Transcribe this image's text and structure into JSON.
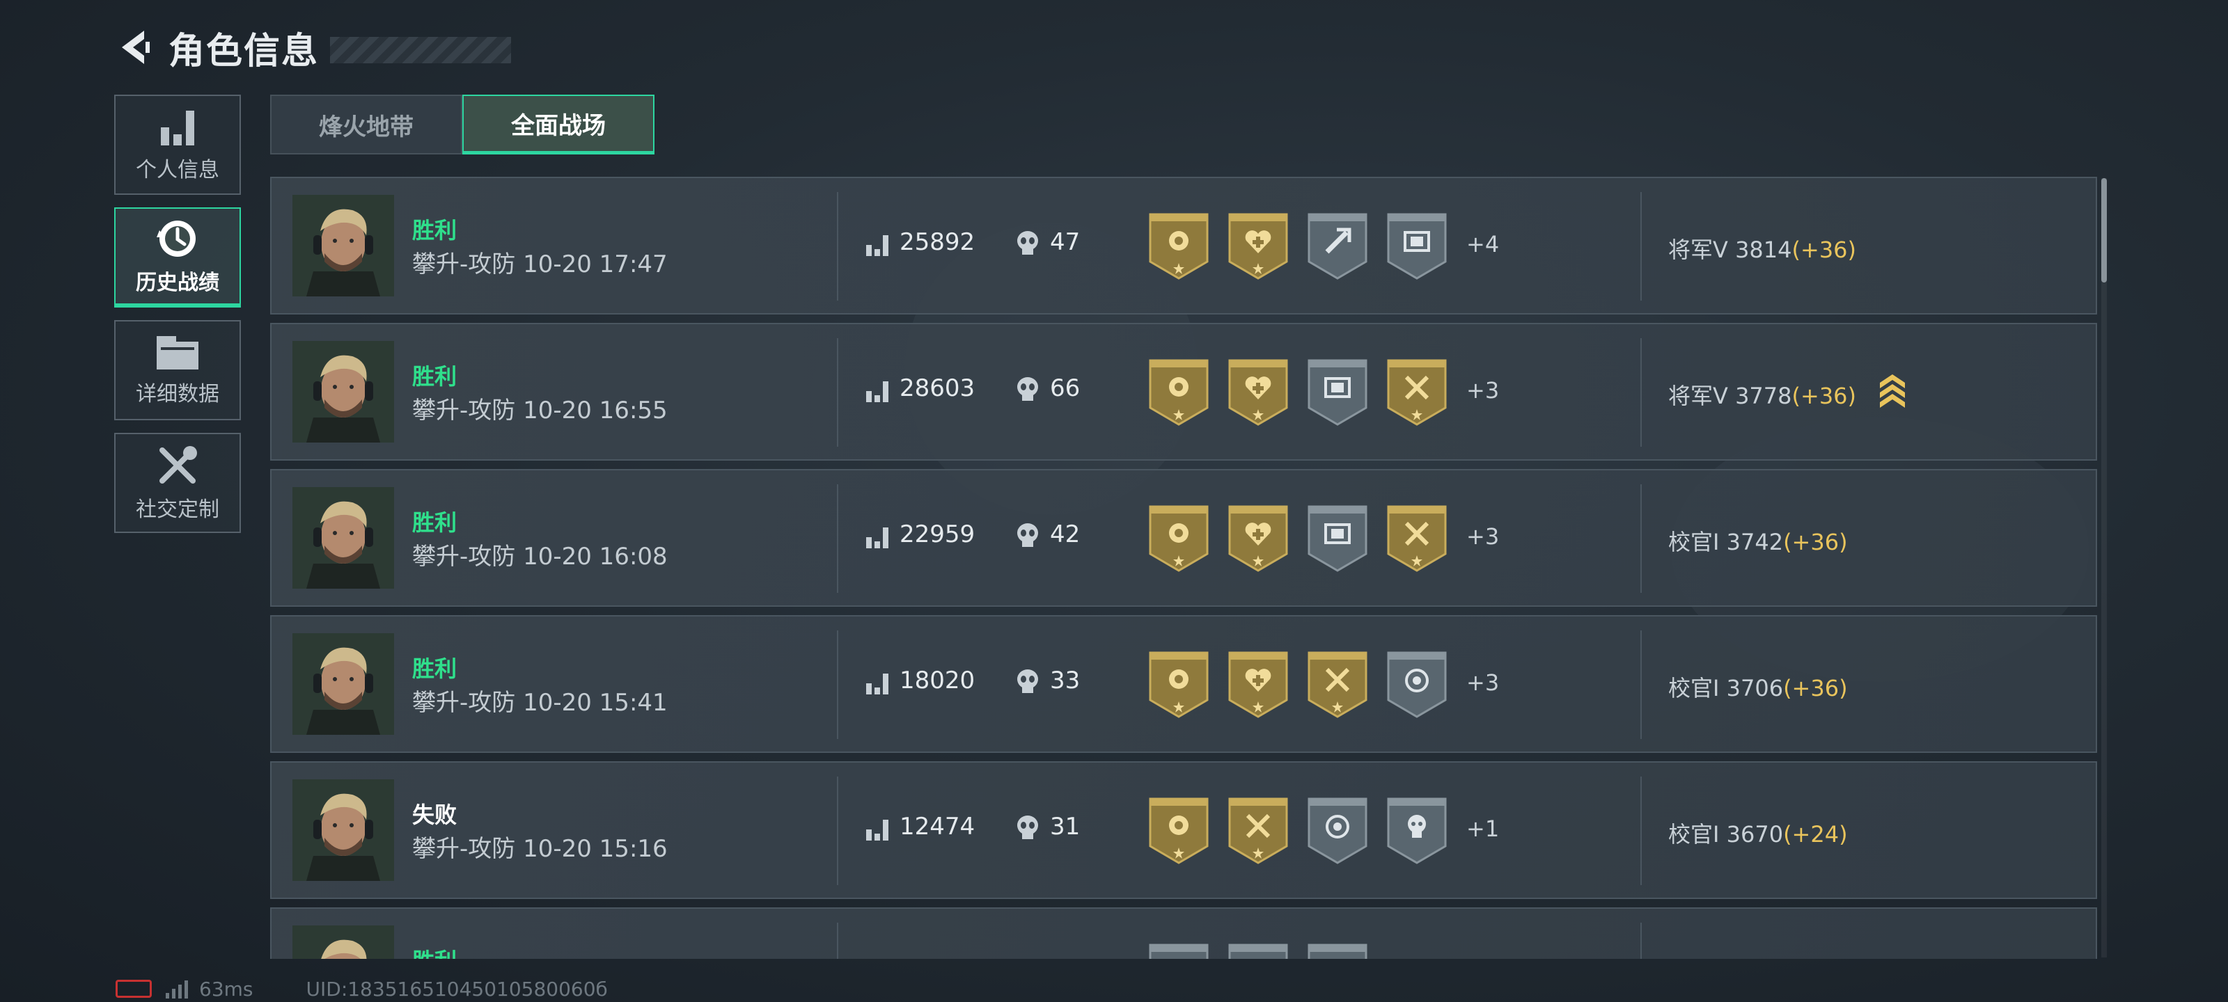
{
  "header": {
    "title": "角色信息"
  },
  "sidebar": {
    "items": [
      {
        "label": "个人信息",
        "icon": "bar-chart-icon"
      },
      {
        "label": "历史战绩",
        "icon": "history-clock-icon",
        "active": true
      },
      {
        "label": "详细数据",
        "icon": "folder-icon"
      },
      {
        "label": "社交定制",
        "icon": "tools-icon"
      }
    ]
  },
  "tabs": [
    {
      "label": "烽火地带",
      "active": false
    },
    {
      "label": "全面战场",
      "active": true
    }
  ],
  "records": [
    {
      "result": "胜利",
      "win": true,
      "mode": "攀升-攻防 10-20 17:47",
      "score": "25892",
      "kills": "47",
      "badges": [
        "gold-rose",
        "gold-heart",
        "gray-repair",
        "gray-supply"
      ],
      "extra": "+4",
      "rank": "将军V 3814",
      "gain": "(+36)",
      "rank_up": false
    },
    {
      "result": "胜利",
      "win": true,
      "mode": "攀升-攻防 10-20 16:55",
      "score": "28603",
      "kills": "66",
      "badges": [
        "gold-rose",
        "gold-heart",
        "gray-supply",
        "gold-axes"
      ],
      "extra": "+3",
      "rank": "将军V 3778",
      "gain": "(+36)",
      "rank_up": true
    },
    {
      "result": "胜利",
      "win": true,
      "mode": "攀升-攻防 10-20 16:08",
      "score": "22959",
      "kills": "42",
      "badges": [
        "gold-rose",
        "gold-heart",
        "gray-supply",
        "gold-axes"
      ],
      "extra": "+3",
      "rank": "校官Ⅰ 3742",
      "gain": "(+36)",
      "rank_up": false
    },
    {
      "result": "胜利",
      "win": true,
      "mode": "攀升-攻防 10-20 15:41",
      "score": "18020",
      "kills": "33",
      "badges": [
        "gold-rose",
        "gold-heart",
        "gold-axes",
        "gray-target-skull"
      ],
      "extra": "+3",
      "rank": "校官Ⅰ 3706",
      "gain": "(+36)",
      "rank_up": false
    },
    {
      "result": "失败",
      "win": false,
      "mode": "攀升-攻防 10-20 15:16",
      "score": "12474",
      "kills": "31",
      "badges": [
        "gold-rose",
        "gold-axes",
        "gray-crosshair",
        "gray-skull"
      ],
      "extra": "+1",
      "rank": "校官Ⅰ 3670",
      "gain": "(+24)",
      "rank_up": false
    },
    {
      "result": "胜利",
      "win": true,
      "mode": "",
      "score": "",
      "kills": "",
      "badges": [
        "gray-star",
        "gray-round",
        "gray-supply"
      ],
      "extra": "",
      "rank": "",
      "gain": "",
      "rank_up": false
    }
  ],
  "footer": {
    "ping": "63ms",
    "uid": "UID:18351651045010580060б"
  },
  "colors": {
    "accent": "#2dd6a0",
    "win": "#2fe08c",
    "gain": "#e9c45c",
    "gold_badge": "#8f7a3c",
    "gray_badge": "#59666f"
  }
}
